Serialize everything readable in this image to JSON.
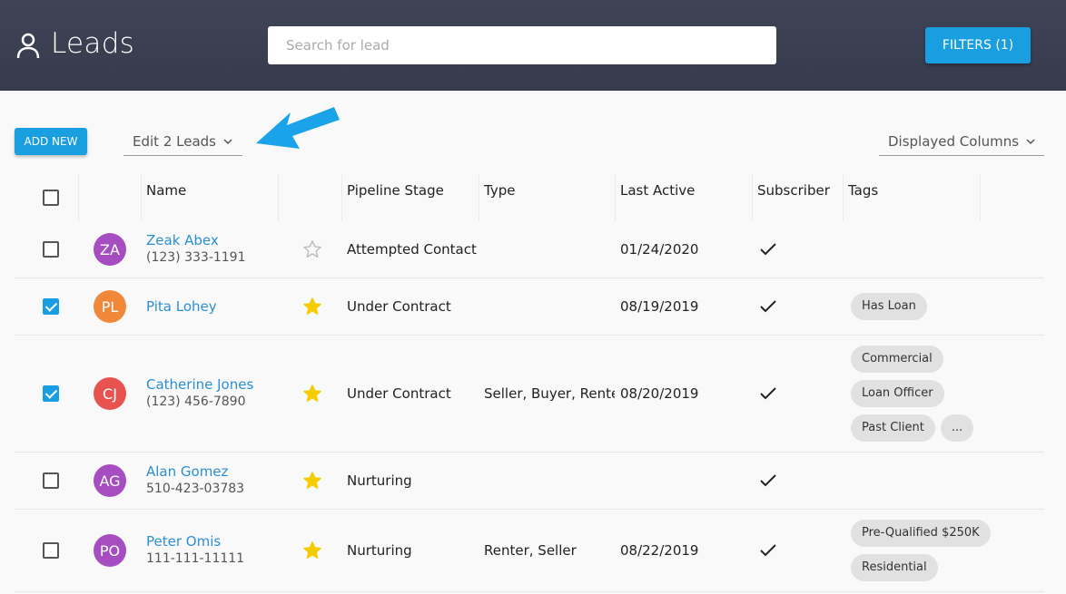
{
  "header": {
    "title": "Leads",
    "search_placeholder": "Search for lead",
    "filters_label": "FILTERS (1)"
  },
  "toolbar": {
    "add_new_label": "ADD NEW",
    "edit_leads_label": "Edit 2 Leads",
    "displayed_columns_label": "Displayed Columns"
  },
  "columns": [
    "Name",
    "Pipeline Stage",
    "Type",
    "Last Active",
    "Subscriber",
    "Tags"
  ],
  "colors": {
    "accent": "#199fe0",
    "header_bg": "#3b4252",
    "star_on": "#f5cc00",
    "link": "#2a8fd4"
  },
  "rows": [
    {
      "checked": false,
      "initials": "ZA",
      "avatar_color": "#a64ec1",
      "name": "Zeak Abex",
      "phone": "(123) 333-1191",
      "starred": false,
      "stage": "Attempted Contact",
      "type": "",
      "last_active": "01/24/2020",
      "subscriber": true,
      "tags": []
    },
    {
      "checked": true,
      "initials": "PL",
      "avatar_color": "#f0883a",
      "name": "Pita Lohey",
      "phone": "",
      "starred": true,
      "stage": "Under Contract",
      "type": "",
      "last_active": "08/19/2019",
      "subscriber": true,
      "tags": [
        "Has Loan"
      ]
    },
    {
      "checked": true,
      "initials": "CJ",
      "avatar_color": "#e8534f",
      "name": "Catherine Jones",
      "phone": "(123) 456-7890",
      "starred": true,
      "stage": "Under Contract",
      "type": "Seller, Buyer, Renter",
      "last_active": "08/20/2019",
      "subscriber": true,
      "tags": [
        "Commercial",
        "Loan Officer",
        "Past Client",
        "..."
      ]
    },
    {
      "checked": false,
      "initials": "AG",
      "avatar_color": "#a64ec1",
      "name": "Alan Gomez",
      "phone": "510-423-03783",
      "starred": true,
      "stage": "Nurturing",
      "type": "",
      "last_active": "",
      "subscriber": true,
      "tags": []
    },
    {
      "checked": false,
      "initials": "PO",
      "avatar_color": "#a64ec1",
      "name": "Peter Omis",
      "phone": "111-111-11111",
      "starred": true,
      "stage": "Nurturing",
      "type": "Renter, Seller",
      "last_active": "08/22/2019",
      "subscriber": true,
      "tags": [
        "Pre-Qualified $250K",
        "Residential"
      ]
    }
  ]
}
